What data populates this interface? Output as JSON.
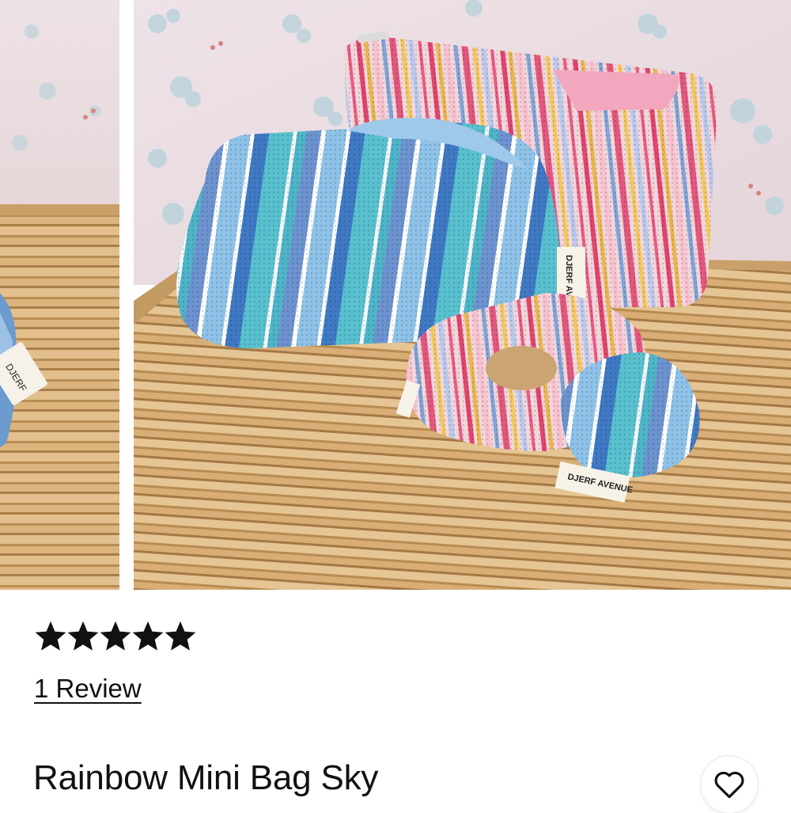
{
  "gallery": {
    "images": [
      {
        "icon": "rainbow-bag-photo-partial"
      },
      {
        "icon": "rainbow-bags-and-scrunchies-photo"
      }
    ]
  },
  "product": {
    "rating": 5,
    "rating_max": 5,
    "review_link_text": "1 Review",
    "title": "Rainbow Mini Bag Sky",
    "wishlist_icon": "heart-outline-icon"
  }
}
